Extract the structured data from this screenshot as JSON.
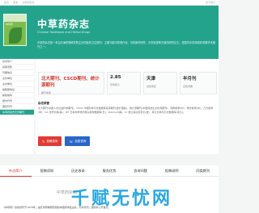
{
  "breadcrumb": [
    "首页",
    "医学",
    "中草药杂志"
  ],
  "topbar_right": "关于我们",
  "journal": {
    "title": "中草药杂志",
    "subtitle": "Chinese Traditional and Herbal Drugs",
    "cover_title": "中草药",
    "description": "中草药杂志是一本由天津药物研究院主办的医药卫生期刊，主要刊载中药现代化、中药新药研究、中药资源等方面的研究论文，是国内中药领域的重要学术期刊之一。"
  },
  "sidebar": {
    "items": [
      "杂志简介",
      "投稿须知",
      "刊期信息",
      "主管单位",
      "主办单位",
      "编辑部地址",
      "邮政编码",
      "国内刊号",
      "国际刊号",
      "中草药杂志天津期刊"
    ]
  },
  "stats": [
    {
      "value": "北大期刊、CSCD期刊、统计源期刊",
      "label": "期刊收录"
    },
    {
      "value": "2.85",
      "label": "影响因子"
    },
    {
      "value": "天津",
      "label": "出版地区"
    },
    {
      "value": "半月刊",
      "label": "出版周期"
    }
  ],
  "info": {
    "title": "杂志荣誉",
    "text": "北大期刊(中国人文社会科学期刊)、CSCD 中国科学引文数据库来源期刊(含扩展版)、统计源期刊(中国科技论文优秀期刊)、知网收录(中)、维普收录(中)、万方收录(中)、CA 化学文摘(美)、JST 日本科学技术振兴机构数据库(日)、Pubmed(美)、IC 波兰哥白尼索引(波)、荷兰文摘与引文数据库(荷兰)。"
  },
  "buttons": {
    "submit": "投稿咨询",
    "subscribe": "加急咨询"
  },
  "tabs": [
    "杂志简介",
    "投稿须知",
    "历史收录",
    "服务优势",
    "咨询问题",
    "投稿说明",
    "同类期刊"
  ],
  "lower": {
    "heading": "中草药杂志",
    "text": "《中草药》杂志创刊于1970年，由天津药物研究院和中国药学会主办，为半月刊，国内外公开发行。"
  },
  "watermark": "千赋无忧网"
}
